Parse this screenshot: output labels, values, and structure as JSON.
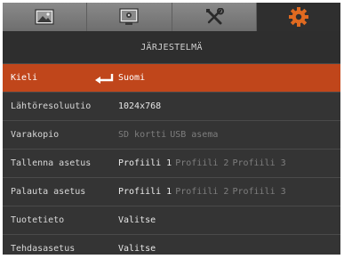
{
  "tabs": [
    {
      "icon": "image-icon",
      "active": false
    },
    {
      "icon": "display-settings-icon",
      "active": false
    },
    {
      "icon": "tools-icon",
      "active": false
    },
    {
      "icon": "gear-icon",
      "active": true
    }
  ],
  "colors": {
    "background": "#343434",
    "selected_row": "#c0461b",
    "active_tab_icon": "#e06a20",
    "dim_text": "#7e7e7e"
  },
  "section_title": "JÄRJESTELMÄ",
  "rows": [
    {
      "label": "Kieli",
      "value": "Suomi",
      "selected": true,
      "enter_icon": "enter-icon"
    },
    {
      "label": "Lähtöresoluutio",
      "value": "1024x768"
    },
    {
      "label": "Varakopio",
      "options": [
        "SD kortti",
        "USB asema"
      ],
      "active_index": -1
    },
    {
      "label": "Tallenna asetus",
      "options": [
        "Profiili 1",
        "Profiili 2",
        "Profiili 3"
      ],
      "active_index": 0
    },
    {
      "label": "Palauta asetus",
      "options": [
        "Profiili 1",
        "Profiili 2",
        "Profiili 3"
      ],
      "active_index": 0
    },
    {
      "label": "Tuotetieto",
      "value": "Valitse"
    },
    {
      "label": "Tehdasasetus",
      "value": "Valitse"
    }
  ]
}
